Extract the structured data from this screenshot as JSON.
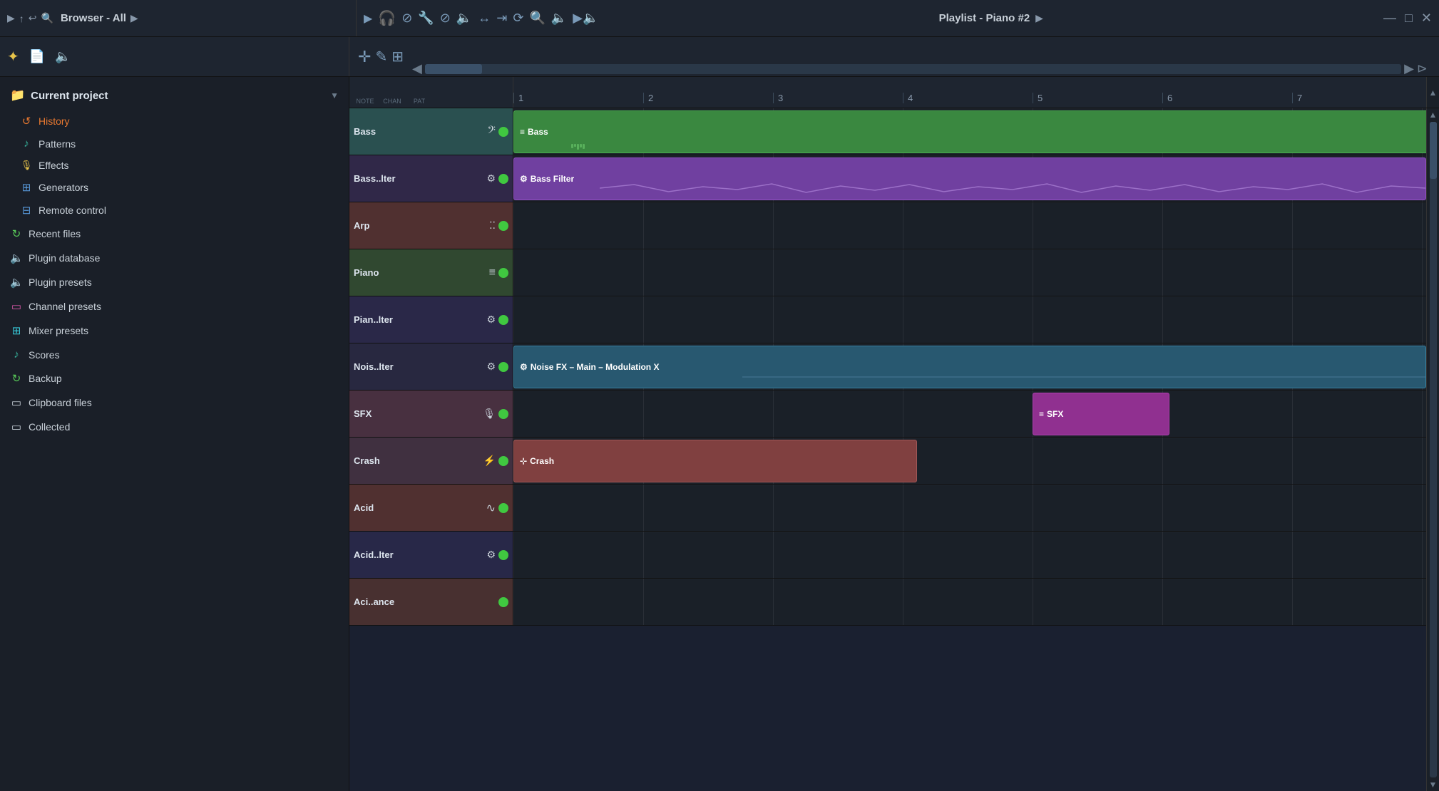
{
  "app": {
    "title_left": "Browser - All",
    "title_right": "Playlist - Piano #2",
    "window_controls": [
      "—",
      "□",
      "✕"
    ]
  },
  "browser": {
    "current_project_label": "Current project",
    "items": [
      {
        "id": "history",
        "label": "History",
        "icon": "↺",
        "color": "color-orange"
      },
      {
        "id": "patterns",
        "label": "Patterns",
        "icon": "♪",
        "color": "color-teal"
      },
      {
        "id": "effects",
        "label": "Effects",
        "icon": "🎙",
        "color": "color-yellow"
      },
      {
        "id": "generators",
        "label": "Generators",
        "icon": "⊞",
        "color": "color-blue"
      },
      {
        "id": "remote-control",
        "label": "Remote control",
        "icon": "⊟",
        "color": "color-blue"
      }
    ],
    "top_items": [
      {
        "id": "recent-files",
        "label": "Recent files",
        "icon": "↻",
        "color": "color-green"
      },
      {
        "id": "plugin-database",
        "label": "Plugin database",
        "icon": "🔈",
        "color": "color-blue"
      },
      {
        "id": "plugin-presets",
        "label": "Plugin presets",
        "icon": "🔈",
        "color": "color-purple"
      },
      {
        "id": "channel-presets",
        "label": "Channel presets",
        "icon": "▭",
        "color": "color-pink"
      },
      {
        "id": "mixer-presets",
        "label": "Mixer presets",
        "icon": "⊞",
        "color": "color-cyan"
      },
      {
        "id": "scores",
        "label": "Scores",
        "icon": "♪",
        "color": "color-teal"
      },
      {
        "id": "backup",
        "label": "Backup",
        "icon": "↻",
        "color": "color-green"
      },
      {
        "id": "clipboard-files",
        "label": "Clipboard files",
        "icon": "▭",
        "color": ""
      },
      {
        "id": "collected",
        "label": "Collected",
        "icon": "▭",
        "color": ""
      }
    ]
  },
  "toolbar": {
    "left_icons": [
      "✦",
      "📄",
      "🔈"
    ],
    "right_icons": [
      "▶",
      "🎧",
      "⊘",
      "🔧",
      "⊘",
      "🔈",
      "↔",
      "≪",
      "⟳",
      "🔍",
      "🔈"
    ]
  },
  "playlist": {
    "title": "Playlist - Piano #2",
    "col_labels": [
      "NOTE",
      "CHAN",
      "PAT"
    ],
    "ruler_marks": [
      "1",
      "2",
      "3",
      "4",
      "5",
      "6",
      "7"
    ],
    "tracks": [
      {
        "id": "bass",
        "name": "Bass",
        "icon": "𝄢",
        "color_class": "track-bass",
        "header_bg": "#2a5050"
      },
      {
        "id": "bass-filter",
        "name": "Bass..lter",
        "icon": "⚙",
        "color_class": "track-bass-filter",
        "header_bg": "#302848"
      },
      {
        "id": "arp",
        "name": "Arp",
        "icon": "⁚",
        "color_class": "track-arp",
        "header_bg": "#503030"
      },
      {
        "id": "piano",
        "name": "Piano",
        "icon": "≡",
        "color_class": "track-piano",
        "header_bg": "#304830"
      },
      {
        "id": "pian-filter",
        "name": "Pian..lter",
        "icon": "⚙",
        "color_class": "track-pian-filter",
        "header_bg": "#2a2848"
      },
      {
        "id": "nois-filter",
        "name": "Nois..lter",
        "icon": "⚙",
        "color_class": "track-nois-filter",
        "header_bg": "#282840"
      },
      {
        "id": "sfx",
        "name": "SFX",
        "icon": "🎙",
        "color_class": "track-sfx",
        "header_bg": "#483040"
      },
      {
        "id": "crash",
        "name": "Crash",
        "icon": "⚡",
        "color_class": "track-crash",
        "header_bg": "#403040"
      },
      {
        "id": "acid",
        "name": "Acid",
        "icon": "∿",
        "color_class": "track-acid",
        "header_bg": "#503030"
      },
      {
        "id": "acid-filter",
        "name": "Acid..lter",
        "icon": "⚙",
        "color_class": "track-acid-filter",
        "header_bg": "#282848"
      },
      {
        "id": "aci-ance",
        "name": "Aci..ance",
        "icon": "",
        "color_class": "track-aci-ance",
        "header_bg": "#483030"
      }
    ],
    "patterns": [
      {
        "track": 0,
        "label": "≡ Bass",
        "start": 0,
        "width": 8,
        "color": "pat-green"
      },
      {
        "track": 0,
        "label": "≡ Bass",
        "start": 8.2,
        "width": 3.8,
        "color": "pat-green"
      },
      {
        "track": 1,
        "label": "⚙ Bass Filter",
        "start": 0,
        "width": 12,
        "color": "pat-purple"
      },
      {
        "track": 5,
        "label": "⚙ Noise FX – Main – Modulation X",
        "start": 0,
        "width": 12,
        "color": "pat-dark-teal"
      },
      {
        "track": 6,
        "label": "≡ SFX",
        "start": 5.6,
        "width": 1.6,
        "color": "pat-pink"
      },
      {
        "track": 7,
        "label": "⊹ Crash",
        "start": 0,
        "width": 4.2,
        "color": "pat-red-brown"
      }
    ]
  }
}
